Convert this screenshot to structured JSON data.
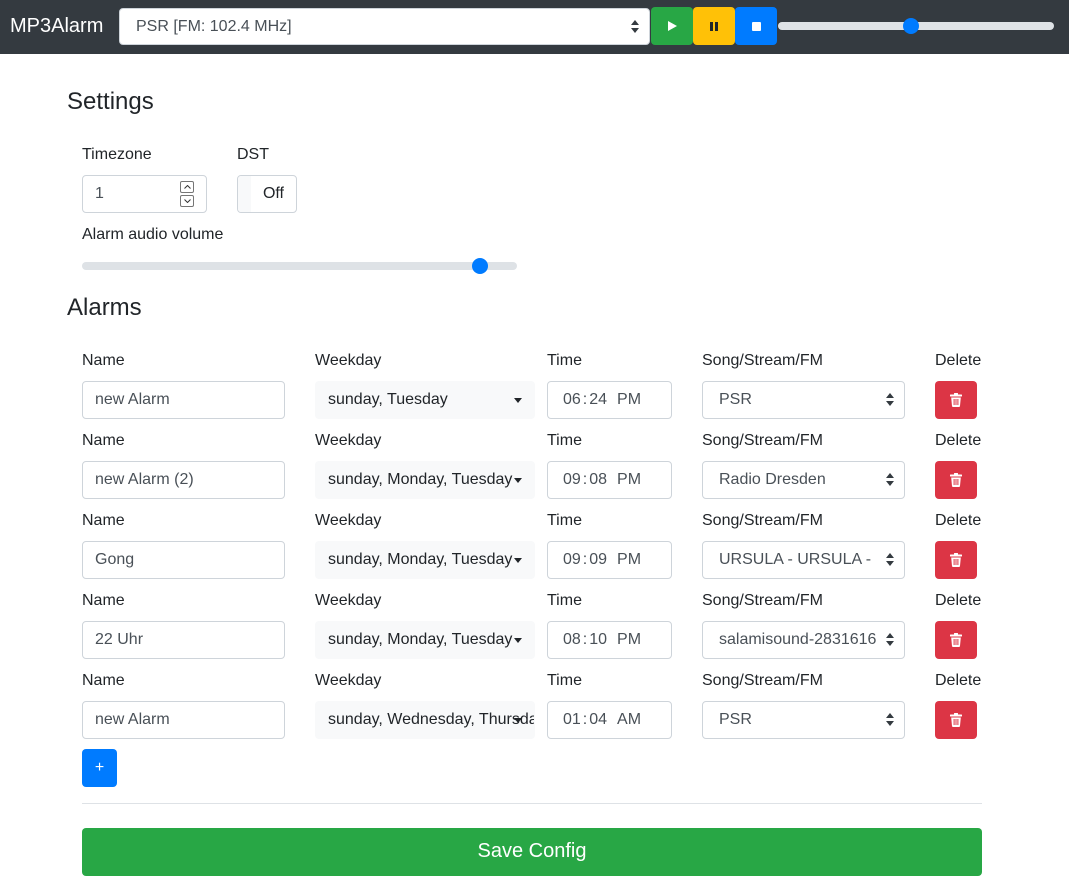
{
  "app": {
    "brand": "MP3Alarm"
  },
  "player": {
    "source_value": "PSR [FM: 102.4 MHz]",
    "play_icon": "play-icon",
    "pause_icon": "pause-icon",
    "stop_icon": "stop-icon",
    "volume_fraction": 0.48
  },
  "settings": {
    "title": "Settings",
    "timezone_label": "Timezone",
    "timezone_value": "1",
    "dst_label": "DST",
    "dst_value": "Off",
    "volume_label": "Alarm audio volume",
    "volume_fraction": 0.93
  },
  "alarms": {
    "title": "Alarms",
    "labels": {
      "name": "Name",
      "weekday": "Weekday",
      "time": "Time",
      "song": "Song/Stream/FM",
      "delete": "Delete"
    },
    "items": [
      {
        "name": "new Alarm",
        "weekday": "sunday, Tuesday",
        "hour": "06",
        "minute": "24",
        "ampm": "PM",
        "song": "PSR"
      },
      {
        "name": "new Alarm (2)",
        "weekday": "sunday, Monday, Tuesday",
        "hour": "09",
        "minute": "08",
        "ampm": "PM",
        "song": "Radio Dresden"
      },
      {
        "name": "Gong",
        "weekday": "sunday, Monday, Tuesday",
        "hour": "09",
        "minute": "09",
        "ampm": "PM",
        "song": "URSULA - URSULA - "
      },
      {
        "name": "22 Uhr",
        "weekday": "sunday, Monday, Tuesday",
        "hour": "08",
        "minute": "10",
        "ampm": "PM",
        "song": "salamisound-2831616"
      },
      {
        "name": "new Alarm",
        "weekday": "sunday, Wednesday, Thursday",
        "hour": "01",
        "minute": "04",
        "ampm": "AM",
        "song": "PSR"
      }
    ],
    "add_label": "+",
    "delete_icon": "trash-icon"
  },
  "save_label": "Save Config",
  "colors": {
    "navbar": "#343a40",
    "primary": "#007bff",
    "success": "#28a745",
    "warning": "#ffc107",
    "danger": "#dc3545"
  }
}
